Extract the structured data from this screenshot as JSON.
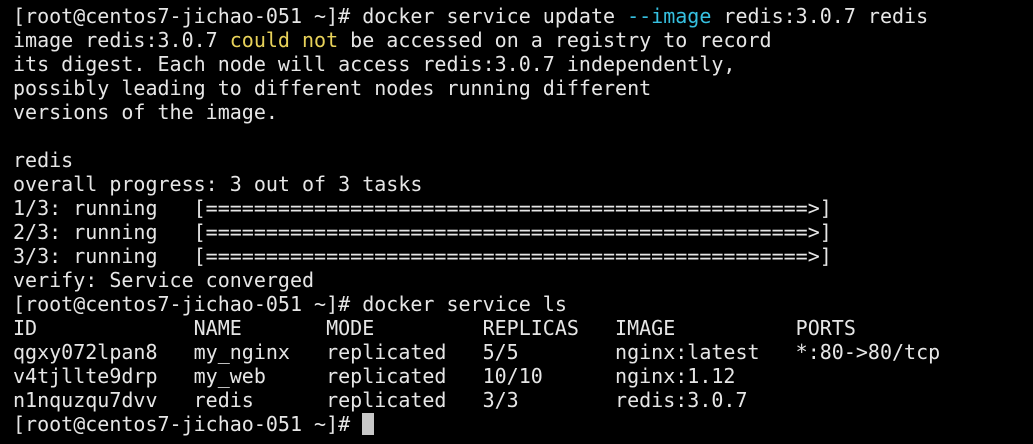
{
  "terminal": {
    "lines": [
      {
        "segments": [
          {
            "text": "[root@centos7-jichao-051 ~]# docker service update "
          },
          {
            "text": "--image",
            "style": "flag"
          },
          {
            "text": " redis:3.0.7 redis"
          }
        ]
      },
      {
        "segments": [
          {
            "text": "image redis:3.0.7 "
          },
          {
            "text": "could not",
            "style": "warn"
          },
          {
            "text": " be accessed on a registry to record"
          }
        ]
      },
      {
        "segments": [
          {
            "text": "its digest. Each node will access redis:3.0.7 independently,"
          }
        ]
      },
      {
        "segments": [
          {
            "text": "possibly leading to different nodes running different"
          }
        ]
      },
      {
        "segments": [
          {
            "text": "versions of the image."
          }
        ]
      },
      {
        "segments": [
          {
            "text": ""
          }
        ]
      },
      {
        "segments": [
          {
            "text": "redis"
          }
        ]
      },
      {
        "segments": [
          {
            "text": "overall progress: 3 out of 3 tasks"
          }
        ]
      },
      {
        "segments": [
          {
            "text": "1/3: running   [==================================================>]"
          }
        ]
      },
      {
        "segments": [
          {
            "text": "2/3: running   [==================================================>]"
          }
        ]
      },
      {
        "segments": [
          {
            "text": "3/3: running   [==================================================>]"
          }
        ]
      },
      {
        "segments": [
          {
            "text": "verify: Service converged"
          }
        ]
      },
      {
        "segments": [
          {
            "text": "[root@centos7-jichao-051 ~]# docker service ls"
          }
        ]
      },
      {
        "segments": [
          {
            "text": "ID             NAME       MODE         REPLICAS   IMAGE          PORTS"
          }
        ]
      },
      {
        "segments": [
          {
            "text": "qgxy072lpan8   my_nginx   replicated   5/5        nginx:latest   *:80->80/tcp"
          }
        ]
      },
      {
        "segments": [
          {
            "text": "v4tjllte9drp   my_web     replicated   10/10      nginx:1.12"
          }
        ]
      },
      {
        "segments": [
          {
            "text": "n1nquzqu7dvv   redis      replicated   3/3        redis:3.0.7"
          }
        ]
      },
      {
        "segments": [
          {
            "text": "[root@centos7-jichao-051 ~]# "
          }
        ],
        "cursor": true
      }
    ]
  }
}
